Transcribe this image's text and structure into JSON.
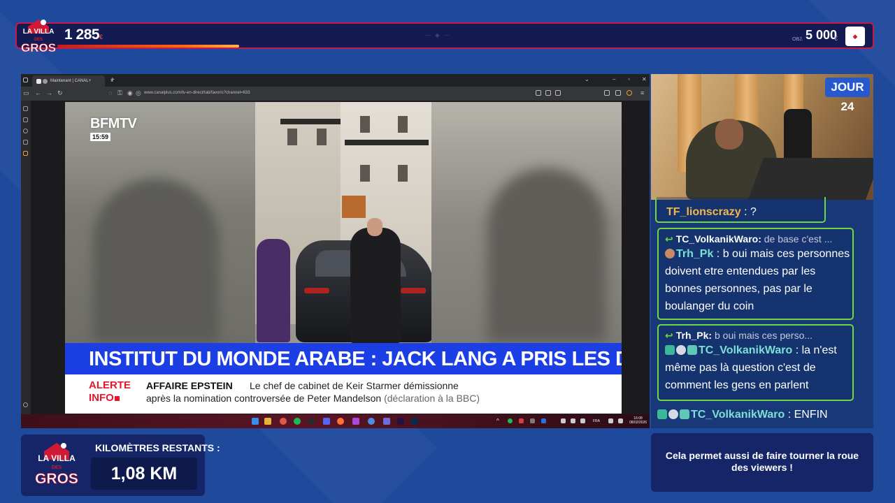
{
  "top_bar": {
    "count": "1 285",
    "count_unit": "€",
    "progress": 0.26,
    "goal_label": "OBJ.",
    "goal_value": "5 000",
    "goal_unit": "€"
  },
  "logo": {
    "line1": "LA VILLA",
    "line2": "DES",
    "line3": "GROS"
  },
  "browser": {
    "tab_title": "Maintenant | CANAL+",
    "url": "www.canalplus.com/tv-en-direct/tab/favoris?channel=633",
    "new_tab": "+",
    "tab_close": "×"
  },
  "video": {
    "channel": "BFMTV",
    "channel_time": "15:59",
    "headline": "INSTITUT DU MONDE ARABE : JACK LANG A PRIS LES DEVANTS",
    "alert_line1": "ALERTE",
    "alert_line2": "INFO",
    "info_topic": "AFFAIRE EPSTEIN",
    "info_text1": "Le chef de cabinet de Keir Starmer démissionne",
    "info_text2": "après la nomination controversée de Peter Mandelson",
    "info_paren": "(déclaration à la BBC)"
  },
  "taskbar": {
    "lang": "FRA",
    "time": "16:08",
    "date": "08/02/2026"
  },
  "cam": {
    "day": "JOUR 24"
  },
  "chat": {
    "msg1": {
      "user": "TF_lionscrazy",
      "text": " : ?"
    },
    "msg2": {
      "reply_user": "TC_VolkanikWaro:",
      "reply_text": " de base c'est ...",
      "user": "Trh_Pk",
      "text": " : b oui mais ces personnes doivent etre entendues par les bonnes personnes, pas par le boulanger du coin"
    },
    "msg3": {
      "reply_user": "Trh_Pk:",
      "reply_text": " b oui mais ces perso...",
      "user": "TC_VolkanikWaro",
      "text": " : la n'est même pas là question c'est de comment les gens en parlent"
    },
    "msg4": {
      "user": "TC_VolkanikWaro",
      "text": " : ENFIN"
    }
  },
  "bottom": {
    "km_label": "KILOMÈTRES RESTANTS :",
    "km_value": "1,08 KM",
    "info_text": "Cela permet aussi de faire tourner la roue des viewers !"
  },
  "colors": {
    "background": "#1f4a9c",
    "accent_red": "#c9184a",
    "chat_border": "#6cd93e",
    "headline_blue": "#1b3fe4"
  }
}
